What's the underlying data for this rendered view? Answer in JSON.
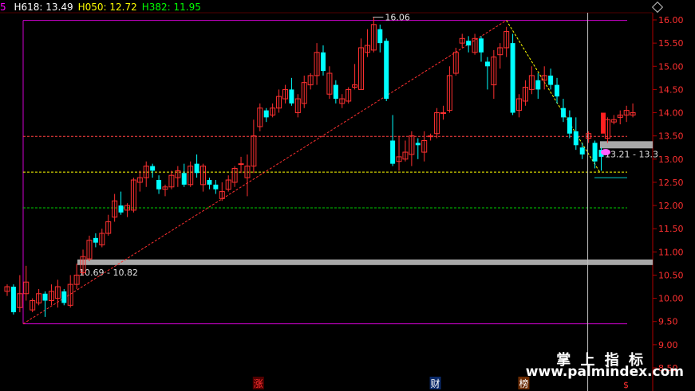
{
  "header": {
    "edge_mark": "5",
    "indicators": [
      {
        "label": "H618:",
        "value": "13.49",
        "color": "#ffffff"
      },
      {
        "label": "H050:",
        "value": "12.72",
        "color": "#ffff00"
      },
      {
        "label": "H382:",
        "value": "11.95",
        "color": "#00ff00"
      }
    ],
    "corner_icon": "diamond-icon"
  },
  "chart_data": {
    "type": "candlestick",
    "ylim": [
      8.5,
      16.2
    ],
    "y_ticks": [
      "16.00",
      "15.50",
      "15.00",
      "14.50",
      "14.00",
      "13.50",
      "13.00",
      "12.50",
      "12.00",
      "11.50",
      "11.00",
      "10.50",
      "10.00",
      "9.50",
      "9.00",
      "8.50"
    ],
    "candles": [
      [
        10.15,
        10.25,
        10.3,
        10.05
      ],
      [
        10.25,
        9.7,
        10.3,
        9.65
      ],
      [
        9.8,
        10.1,
        10.5,
        9.7
      ],
      [
        10.1,
        10.35,
        10.7,
        9.95
      ],
      [
        9.75,
        9.95,
        10.0,
        9.7
      ],
      [
        9.9,
        10.1,
        10.2,
        9.85
      ],
      [
        10.1,
        9.95,
        10.15,
        9.6
      ],
      [
        9.95,
        10.15,
        10.3,
        9.85
      ],
      [
        10.0,
        10.25,
        10.4,
        9.8
      ],
      [
        10.15,
        9.9,
        10.2,
        9.85
      ],
      [
        9.85,
        10.3,
        10.5,
        9.8
      ],
      [
        10.3,
        10.5,
        10.75,
        10.2
      ],
      [
        10.55,
        10.9,
        11.05,
        10.5
      ],
      [
        10.85,
        11.25,
        11.35,
        10.8
      ],
      [
        11.3,
        11.2,
        11.4,
        11.1
      ],
      [
        11.15,
        11.4,
        11.5,
        11.1
      ],
      [
        11.4,
        11.65,
        11.8,
        11.35
      ],
      [
        11.75,
        12.1,
        12.25,
        11.65
      ],
      [
        12.0,
        11.85,
        12.3,
        11.8
      ],
      [
        11.9,
        12.0,
        12.05,
        11.75
      ],
      [
        11.9,
        12.55,
        12.6,
        11.85
      ],
      [
        12.5,
        12.6,
        12.75,
        12.3
      ],
      [
        12.6,
        12.85,
        12.95,
        12.4
      ],
      [
        12.85,
        12.75,
        12.9,
        12.6
      ],
      [
        12.55,
        12.35,
        12.65,
        12.25
      ],
      [
        12.35,
        12.4,
        12.45,
        12.2
      ],
      [
        12.4,
        12.65,
        12.75,
        12.35
      ],
      [
        12.6,
        12.75,
        12.85,
        12.4
      ],
      [
        12.7,
        12.45,
        12.9,
        12.4
      ],
      [
        12.45,
        12.85,
        12.95,
        12.4
      ],
      [
        12.9,
        12.7,
        13.1,
        12.6
      ],
      [
        12.45,
        12.85,
        12.9,
        12.3
      ],
      [
        12.55,
        12.45,
        12.6,
        12.35
      ],
      [
        12.45,
        12.35,
        12.55,
        12.25
      ],
      [
        12.15,
        12.3,
        12.5,
        12.1
      ],
      [
        12.35,
        12.55,
        12.65,
        12.3
      ],
      [
        12.5,
        12.8,
        12.85,
        12.4
      ],
      [
        12.9,
        12.9,
        13.05,
        12.7
      ],
      [
        12.6,
        12.85,
        13.1,
        12.2
      ],
      [
        12.85,
        13.5,
        13.85,
        12.7
      ],
      [
        13.7,
        14.1,
        14.2,
        13.6
      ],
      [
        14.05,
        13.9,
        14.1,
        13.8
      ],
      [
        13.95,
        14.1,
        14.2,
        13.9
      ],
      [
        14.1,
        14.35,
        14.5,
        14.0
      ],
      [
        14.3,
        14.5,
        14.6,
        14.2
      ],
      [
        14.5,
        14.2,
        14.75,
        14.15
      ],
      [
        14.0,
        14.3,
        14.4,
        13.9
      ],
      [
        14.2,
        14.65,
        14.8,
        14.1
      ],
      [
        14.6,
        14.8,
        14.85,
        14.5
      ],
      [
        14.8,
        15.3,
        15.5,
        14.6
      ],
      [
        15.3,
        14.9,
        15.45,
        14.8
      ],
      [
        14.4,
        14.85,
        15.0,
        14.3
      ],
      [
        14.6,
        14.3,
        14.7,
        14.2
      ],
      [
        14.2,
        14.3,
        14.4,
        14.1
      ],
      [
        14.25,
        14.5,
        14.55,
        14.2
      ],
      [
        14.55,
        14.6,
        15.05,
        14.5
      ],
      [
        14.5,
        15.4,
        15.6,
        14.5
      ],
      [
        15.3,
        15.45,
        15.8,
        15.2
      ],
      [
        15.35,
        15.9,
        16.06,
        15.3
      ],
      [
        15.8,
        15.5,
        15.9,
        15.3
      ],
      [
        15.55,
        14.3,
        15.6,
        14.25
      ],
      [
        13.4,
        12.9,
        13.95,
        12.85
      ],
      [
        12.95,
        13.05,
        13.5,
        12.75
      ],
      [
        13.0,
        13.15,
        13.4,
        12.95
      ],
      [
        13.1,
        13.5,
        13.6,
        12.85
      ],
      [
        13.35,
        13.3,
        13.45,
        13.0
      ],
      [
        13.15,
        13.4,
        13.6,
        12.95
      ],
      [
        13.5,
        13.5,
        13.55,
        13.4
      ],
      [
        13.55,
        14.0,
        14.1,
        13.45
      ],
      [
        14.0,
        14.0,
        14.15,
        13.85
      ],
      [
        14.05,
        14.8,
        15.0,
        14.0
      ],
      [
        14.85,
        15.3,
        15.4,
        14.8
      ],
      [
        15.5,
        15.6,
        15.7,
        15.4
      ],
      [
        15.55,
        15.45,
        15.65,
        15.3
      ],
      [
        15.3,
        15.6,
        15.7,
        15.25
      ],
      [
        15.6,
        15.3,
        15.65,
        15.1
      ],
      [
        15.1,
        15.0,
        15.2,
        14.5
      ],
      [
        14.6,
        15.2,
        15.35,
        14.3
      ],
      [
        15.25,
        15.4,
        15.5,
        14.95
      ],
      [
        15.4,
        15.75,
        15.85,
        15.2
      ],
      [
        15.5,
        14.0,
        15.7,
        13.95
      ],
      [
        14.05,
        14.3,
        14.4,
        13.9
      ],
      [
        14.25,
        14.55,
        14.7,
        14.15
      ],
      [
        14.5,
        14.8,
        15.0,
        14.4
      ],
      [
        14.7,
        14.5,
        14.85,
        14.3
      ],
      [
        14.7,
        14.8,
        15.0,
        14.5
      ],
      [
        14.8,
        14.6,
        14.95,
        14.5
      ],
      [
        14.6,
        14.35,
        14.75,
        14.2
      ],
      [
        14.1,
        13.9,
        14.3,
        13.8
      ],
      [
        13.9,
        13.55,
        14.05,
        13.45
      ],
      [
        13.6,
        13.3,
        13.9,
        13.2
      ],
      [
        13.25,
        13.1,
        13.35,
        13.0
      ],
      [
        13.45,
        13.55,
        13.6,
        13.35
      ],
      [
        13.35,
        12.95,
        13.4,
        12.8
      ],
      [
        13.2,
        13.05,
        13.25,
        12.75
      ],
      [
        13.45,
        13.85,
        13.9,
        13.35
      ],
      [
        13.8,
        13.85,
        13.95,
        13.75
      ],
      [
        13.9,
        13.95,
        14.05,
        13.75
      ],
      [
        13.95,
        14.05,
        14.15,
        13.8
      ],
      [
        13.95,
        14.0,
        14.2,
        13.9
      ]
    ],
    "hlines": [
      {
        "value": 13.49,
        "color": "#ff4040",
        "style": "dashed"
      },
      {
        "value": 12.72,
        "color": "#ffff00",
        "style": "dashed"
      },
      {
        "value": 11.95,
        "color": "#00cc00",
        "style": "dashed"
      }
    ],
    "zones": [
      {
        "low": 10.69,
        "high": 10.82,
        "label": "10.69 - 10.82"
      },
      {
        "low": 13.21,
        "high": 13.3,
        "label": "13.21 - 13.3"
      }
    ],
    "peak_label": "16.06",
    "vertical_cursor_index": 93,
    "bottom_markers": [
      {
        "text": "涨",
        "bg": "#500000",
        "fg": "#ff3030",
        "index": 40
      },
      {
        "text": "财",
        "bg": "#0a2a6a",
        "fg": "#ffffff",
        "index": 68
      },
      {
        "text": "榜",
        "bg": "#6a2a00",
        "fg": "#ffffff",
        "index": 82
      }
    ],
    "footer_mark": "$"
  },
  "watermark": {
    "line1": "掌 上 指 标",
    "line2": "www.palmindex.com"
  }
}
